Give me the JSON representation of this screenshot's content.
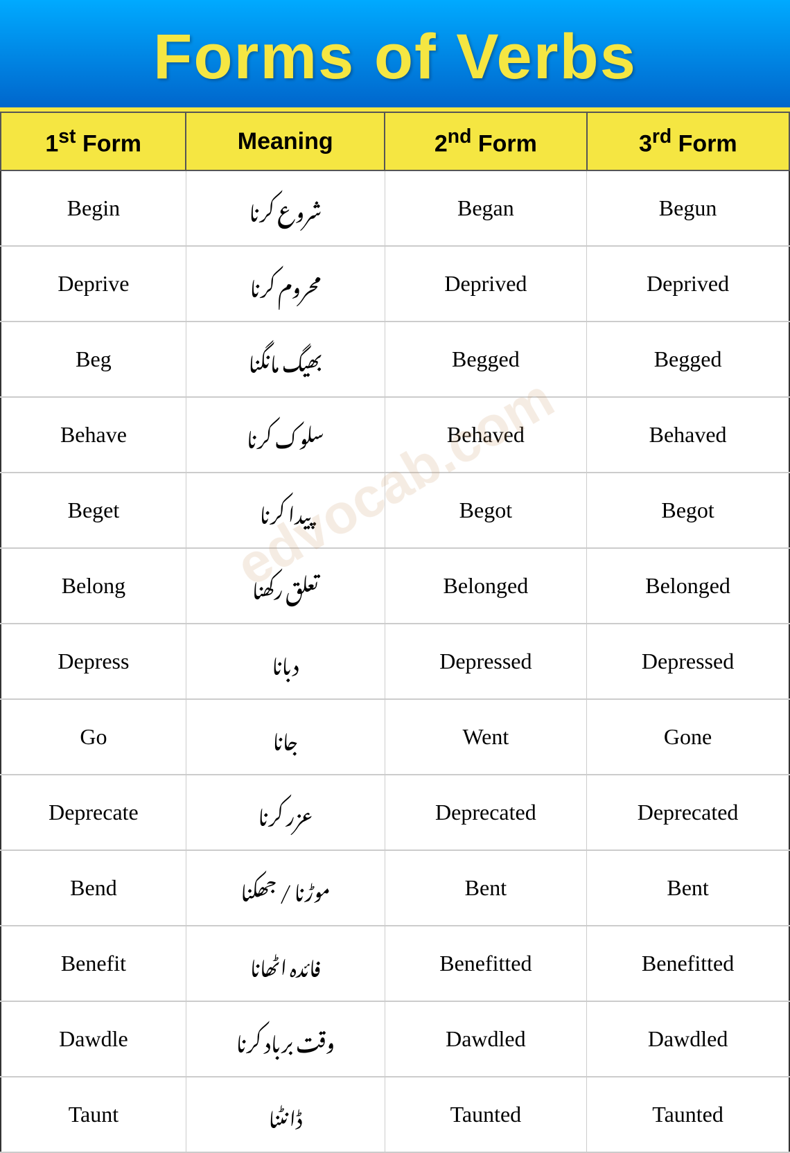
{
  "header": {
    "title": "Forms of Verbs"
  },
  "table": {
    "columns": [
      {
        "label": "1",
        "sup": "st",
        "rest": " Form"
      },
      {
        "label": "Meaning"
      },
      {
        "label": "2",
        "sup": "nd",
        "rest": " Form"
      },
      {
        "label": "3",
        "sup": "rd",
        "rest": " Form"
      }
    ],
    "rows": [
      {
        "form1": "Begin",
        "meaning": "شروع کرنا",
        "form2": "Began",
        "form3": "Begun"
      },
      {
        "form1": "Deprive",
        "meaning": "محروم کرنا",
        "form2": "Deprived",
        "form3": "Deprived"
      },
      {
        "form1": "Beg",
        "meaning": "بھیگ مانگنا",
        "form2": "Begged",
        "form3": "Begged"
      },
      {
        "form1": "Behave",
        "meaning": "سلوک کرنا",
        "form2": "Behaved",
        "form3": "Behaved"
      },
      {
        "form1": "Beget",
        "meaning": "پیدا کرنا",
        "form2": "Begot",
        "form3": "Begot"
      },
      {
        "form1": "Belong",
        "meaning": "تعلق رکھنا",
        "form2": "Belonged",
        "form3": "Belonged"
      },
      {
        "form1": "Depress",
        "meaning": "دبانا",
        "form2": "Depressed",
        "form3": "Depressed"
      },
      {
        "form1": "Go",
        "meaning": "جانا",
        "form2": "Went",
        "form3": "Gone"
      },
      {
        "form1": "Deprecate",
        "meaning": "عزر کرنا",
        "form2": "Deprecated",
        "form3": "Deprecated"
      },
      {
        "form1": "Bend",
        "meaning": "موڑنا / جھکنا",
        "form2": "Bent",
        "form3": "Bent"
      },
      {
        "form1": "Benefit",
        "meaning": "فائدہ اٹھانا",
        "form2": "Benefitted",
        "form3": "Benefitted"
      },
      {
        "form1": "Dawdle",
        "meaning": "وقت برباد کرنا",
        "form2": "Dawdled",
        "form3": "Dawdled"
      },
      {
        "form1": "Taunt",
        "meaning": "ڈانٹنا",
        "form2": "Taunted",
        "form3": "Taunted"
      }
    ]
  },
  "watermark": "edvocab.com"
}
